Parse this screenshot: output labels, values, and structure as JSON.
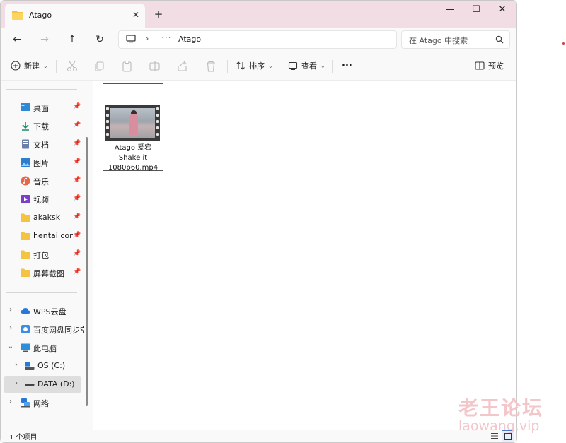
{
  "window": {
    "tab_title": "Atago",
    "tab_close": "✕",
    "new_tab": "+",
    "minimize": "—",
    "maximize": "☐",
    "close": "✕"
  },
  "nav": {
    "back": "←",
    "forward": "→",
    "up": "↑",
    "refresh": "↻",
    "address": {
      "separator": "›",
      "overflow": "···",
      "current_folder": "Atago"
    },
    "search_placeholder": "在 Atago 中搜索"
  },
  "command_bar": {
    "new_label": "新建",
    "sort_label": "排序",
    "view_label": "查看",
    "more_label": "···",
    "preview_label": "预览"
  },
  "sidebar": {
    "quick_access": [
      {
        "label": "桌面",
        "icon": "desktop-icon",
        "pinned": true
      },
      {
        "label": "下载",
        "icon": "download-icon",
        "pinned": true
      },
      {
        "label": "文档",
        "icon": "document-icon",
        "pinned": true
      },
      {
        "label": "图片",
        "icon": "picture-icon",
        "pinned": true
      },
      {
        "label": "音乐",
        "icon": "music-icon",
        "pinned": true
      },
      {
        "label": "视频",
        "icon": "video-icon",
        "pinned": true
      },
      {
        "label": "akaksk",
        "icon": "folder-icon",
        "pinned": true
      },
      {
        "label": "hentai conte",
        "icon": "folder-icon",
        "pinned": true
      },
      {
        "label": "打包",
        "icon": "folder-icon",
        "pinned": true
      },
      {
        "label": "屏幕截图",
        "icon": "folder-icon",
        "pinned": true
      }
    ],
    "tree": [
      {
        "label": "WPS云盘",
        "icon": "cloud-icon",
        "expanded": false
      },
      {
        "label": "百度网盘同步空",
        "icon": "baidu-sync-icon",
        "expanded": false
      },
      {
        "label": "此电脑",
        "icon": "computer-icon",
        "expanded": true
      },
      {
        "label": "OS (C:)",
        "icon": "os-drive-icon",
        "expanded": false
      },
      {
        "label": "DATA (D:)",
        "icon": "drive-icon",
        "expanded": false,
        "selected": true
      },
      {
        "label": "网络",
        "icon": "network-icon",
        "expanded": false
      }
    ]
  },
  "files": [
    {
      "name": "Atago 爱宕 Shake it 1080p60.mp4",
      "icon": "video-thumbnail-icon"
    }
  ],
  "status": {
    "item_count": "1 个项目"
  },
  "watermark": {
    "cn": "老王论坛",
    "en": "laowang.vip"
  }
}
